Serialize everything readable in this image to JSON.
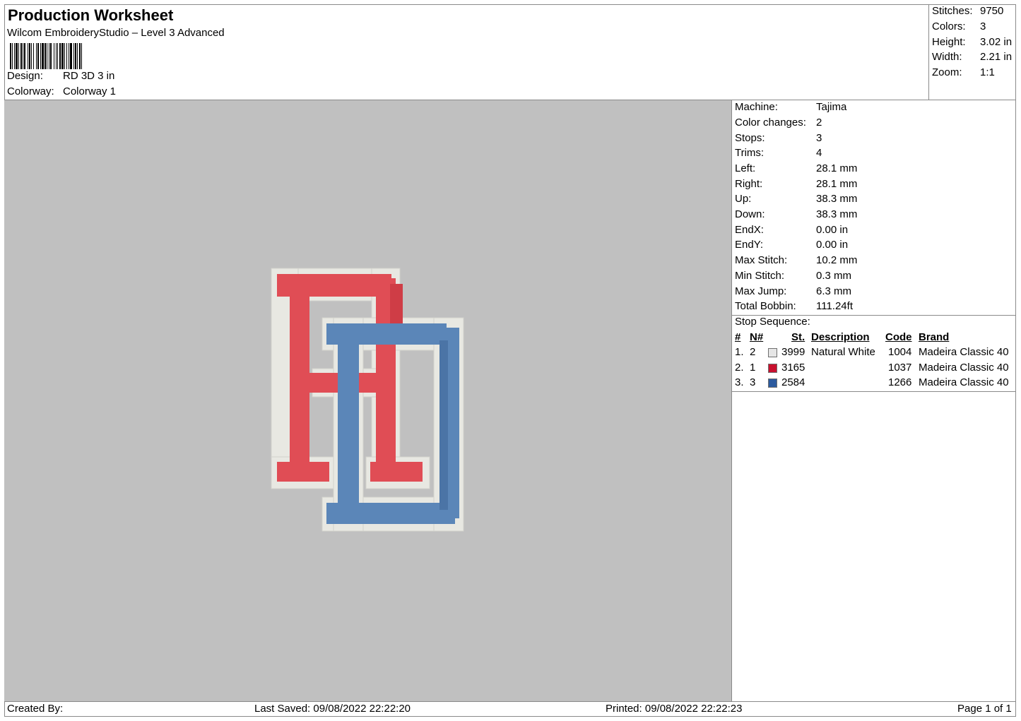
{
  "header": {
    "title": "Production Worksheet",
    "software": "Wilcom EmbroideryStudio – Level 3 Advanced",
    "design_label": "Design:",
    "design_value": "RD 3D 3 in",
    "colorway_label": "Colorway:",
    "colorway_value": "Colorway 1"
  },
  "summary": [
    {
      "label": "Stitches:",
      "value": "9750"
    },
    {
      "label": "Colors:",
      "value": "3"
    },
    {
      "label": "Height:",
      "value": "3.02 in"
    },
    {
      "label": "Width:",
      "value": "2.21 in"
    },
    {
      "label": "Zoom:",
      "value": "1:1"
    }
  ],
  "machine_info": [
    {
      "label": "Machine:",
      "value": "Tajima"
    },
    {
      "label": "Color changes:",
      "value": "2"
    },
    {
      "label": "Stops:",
      "value": "3"
    },
    {
      "label": "Trims:",
      "value": "4"
    },
    {
      "label": "Left:",
      "value": "28.1 mm"
    },
    {
      "label": "Right:",
      "value": "28.1 mm"
    },
    {
      "label": "Up:",
      "value": "38.3 mm"
    },
    {
      "label": "Down:",
      "value": "38.3 mm"
    },
    {
      "label": "EndX:",
      "value": "0.00 in"
    },
    {
      "label": "EndY:",
      "value": "0.00 in"
    },
    {
      "label": "Max Stitch:",
      "value": "10.2 mm"
    },
    {
      "label": "Min Stitch:",
      "value": "0.3 mm"
    },
    {
      "label": "Max Jump:",
      "value": "6.3 mm"
    },
    {
      "label": "Total Bobbin:",
      "value": "111.24ft"
    }
  ],
  "stop_sequence": {
    "title": "Stop Sequence:",
    "headers": {
      "num": "#",
      "n": "N#",
      "st": "St.",
      "description": "Description",
      "code": "Code",
      "brand": "Brand"
    },
    "rows": [
      {
        "num": "1.",
        "n": "2",
        "color": "#e6e6e6",
        "st": "3999",
        "description": "Natural White",
        "code": "1004",
        "brand": "Madeira Classic 40"
      },
      {
        "num": "2.",
        "n": "1",
        "color": "#c8102e",
        "st": "3165",
        "description": "",
        "code": "1037",
        "brand": "Madeira Classic 40"
      },
      {
        "num": "3.",
        "n": "3",
        "color": "#2c5a9e",
        "st": "2584",
        "description": "",
        "code": "1266",
        "brand": "Madeira Classic 40"
      }
    ]
  },
  "footer": {
    "created_by": "Created By:",
    "last_saved": "Last Saved: 09/08/2022 22:22:20",
    "printed": "Printed: 09/08/2022 22:22:23",
    "page": "Page 1 of 1"
  },
  "preview": {
    "background_color": "#c0c0c0",
    "thread_colors": {
      "white": "#e8e8e2",
      "red": "#e04d55",
      "blue": "#5b86b8"
    }
  }
}
